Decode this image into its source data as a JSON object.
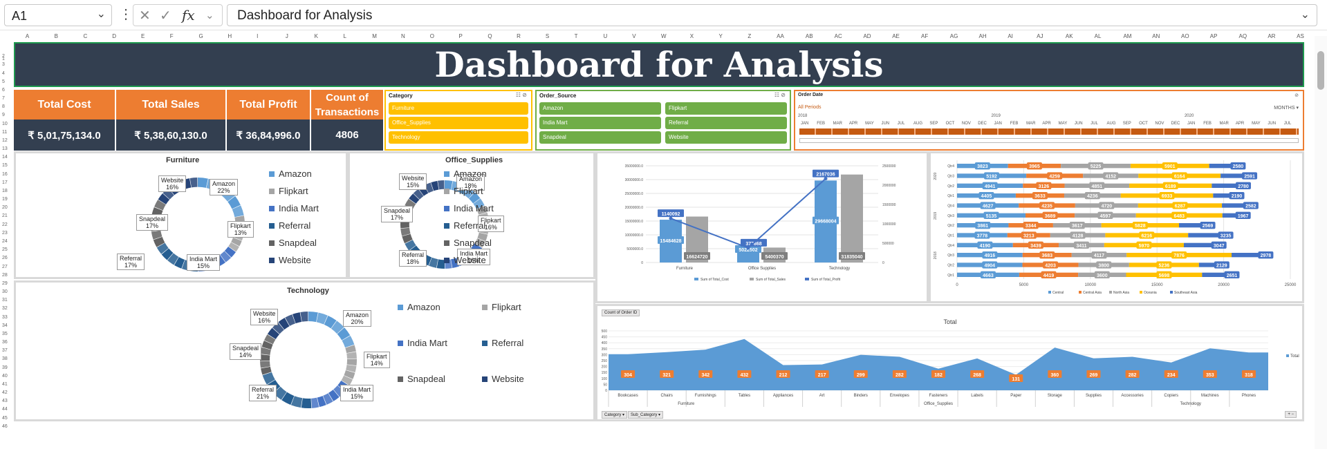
{
  "formula_bar": {
    "cell_ref": "A1",
    "formula": "Dashboard for Analysis"
  },
  "columns": [
    "A",
    "B",
    "C",
    "D",
    "E",
    "F",
    "G",
    "H",
    "I",
    "J",
    "K",
    "L",
    "M",
    "N",
    "O",
    "P",
    "Q",
    "R",
    "S",
    "T",
    "U",
    "V",
    "W",
    "X",
    "Y",
    "Z",
    "AA",
    "AB",
    "AC",
    "AD",
    "AE",
    "AF",
    "AG",
    "AH",
    "AI",
    "AJ",
    "AK",
    "AL",
    "AM",
    "AN",
    "AO",
    "AP",
    "AQ",
    "AR",
    "AS"
  ],
  "rows": [
    "1",
    "2",
    "3",
    "4",
    "5",
    "6",
    "7",
    "8",
    "9",
    "10",
    "11",
    "12",
    "13",
    "14",
    "15",
    "16",
    "17",
    "18",
    "19",
    "20",
    "21",
    "22",
    "23",
    "24",
    "25",
    "26",
    "27",
    "28",
    "29",
    "30",
    "31",
    "32",
    "33",
    "34",
    "35",
    "36",
    "37",
    "38",
    "39",
    "40",
    "41",
    "42",
    "43",
    "44",
    "45",
    "46"
  ],
  "title": "Dashboard for Analysis",
  "kpis": [
    {
      "label": "Total Cost",
      "value": "₹ 5,01,75,134.0"
    },
    {
      "label": "Total Sales",
      "value": "₹ 5,38,60,130.0"
    },
    {
      "label": "Total Profit",
      "value": "₹ 36,84,996.0"
    },
    {
      "label": "Count of Transactions",
      "value": "4806"
    }
  ],
  "slicer_category": {
    "title": "Category",
    "items": [
      "Furniture",
      "Office_Supplies",
      "Technology"
    ],
    "color": "#ffc000"
  },
  "slicer_order_source": {
    "title": "Order_Source",
    "items": [
      "Amazon",
      "Flipkart",
      "India Mart",
      "Referral",
      "Snapdeal",
      "Website"
    ],
    "color": "#70ad47"
  },
  "timeline": {
    "title": "Order Date",
    "period_label": "All Periods",
    "level": "MONTHS",
    "years": [
      "2018",
      "2019",
      "2020"
    ],
    "months": [
      "JAN",
      "FEB",
      "MAR",
      "APR",
      "MAY",
      "JUN",
      "JUL",
      "AUG",
      "SEP",
      "OCT",
      "NOV",
      "DEC",
      "JAN",
      "FEB",
      "MAR",
      "APR",
      "MAY",
      "JUN",
      "JUL",
      "AUG",
      "SEP",
      "OCT",
      "NOV",
      "DEC",
      "JAN",
      "FEB",
      "MAR",
      "APR",
      "MAY",
      "JUN",
      "JUL"
    ]
  },
  "colors": {
    "amazon": "#5b9bd5",
    "flipkart": "#a5a5a5",
    "india_mart": "#4472c4",
    "referral": "#255e91",
    "snapdeal": "#636363",
    "website": "#264478",
    "orange": "#ed7d31",
    "navy": "#333f50"
  },
  "pies": {
    "furniture": {
      "title": "Furniture",
      "legend": [
        "Amazon",
        "Flipkart",
        "India Mart",
        "Referral",
        "Snapdeal",
        "Website"
      ],
      "labels": [
        {
          "n": "Amazon",
          "p": "22%"
        },
        {
          "n": "Flipkart",
          "p": "13%"
        },
        {
          "n": "India Mart",
          "p": "15%"
        },
        {
          "n": "Referral",
          "p": "17%"
        },
        {
          "n": "Snapdeal",
          "p": "17%"
        },
        {
          "n": "Website",
          "p": "16%"
        }
      ]
    },
    "office": {
      "title": "Office_Supplies",
      "legend": [
        "Amazon",
        "Flipkart",
        "India Mart",
        "Referral",
        "Snapdeal",
        "Website"
      ],
      "labels": [
        {
          "n": "Amazon",
          "p": "18%"
        },
        {
          "n": "Flipkart",
          "p": "16%"
        },
        {
          "n": "India Mart",
          "p": "16%"
        },
        {
          "n": "Referral",
          "p": "18%"
        },
        {
          "n": "Snapdeal",
          "p": "17%"
        },
        {
          "n": "Website",
          "p": "15%"
        }
      ]
    },
    "technology": {
      "title": "Technology",
      "legend": [
        "Amazon",
        "Flipkart",
        "India Mart",
        "Referral",
        "Snapdeal",
        "Website"
      ],
      "labels": [
        {
          "n": "Amazon",
          "p": "20%"
        },
        {
          "n": "Flipkart",
          "p": "14%"
        },
        {
          "n": "India Mart",
          "p": "15%"
        },
        {
          "n": "Referral",
          "p": "21%"
        },
        {
          "n": "Snapdeal",
          "p": "14%"
        },
        {
          "n": "Website",
          "p": "16%"
        }
      ]
    }
  },
  "chart_data": [
    {
      "type": "bar",
      "title": "",
      "categories": [
        "Furniture",
        "Office Supplies",
        "Technology"
      ],
      "series": [
        {
          "name": "Sum of Total_Cost",
          "values": [
            15484628,
            5022502,
            29668004
          ]
        },
        {
          "name": "Sum of Total_Sales",
          "values": [
            16624720,
            5400370,
            31835040
          ]
        },
        {
          "name": "Sum of Total_Profit",
          "values": [
            1140092,
            377868,
            2167036
          ],
          "axis": "secondary",
          "type": "line"
        }
      ],
      "y_ticks": [
        "0",
        "5000000.0",
        "10000000.0",
        "15000000.0",
        "20000000.0",
        "25000000.0",
        "30000000.0",
        "35000000.0"
      ],
      "y2_ticks": [
        "0",
        "500000",
        "1000000",
        "1500000",
        "2000000",
        "2500000"
      ],
      "ylim": [
        0,
        35000000
      ],
      "y2lim": [
        0,
        2500000
      ],
      "legend": [
        "Sum of Total_Cost",
        "Sum of Total_Sales",
        "Sum of Total_Profit"
      ]
    },
    {
      "type": "bar",
      "orientation": "horizontal",
      "stacked": true,
      "categories": [
        "Qtr1 2018",
        "Qtr2 2018",
        "Qtr3 2018",
        "Qtr4 2018",
        "Qtr1 2019",
        "Qtr2 2019",
        "Qtr3 2019",
        "Qtr4 2019",
        "Qtr1 2020",
        "Qtr2 2020",
        "Qtr3 2020",
        "Qtr4 2020"
      ],
      "category_labels": [
        "Qtr1",
        "Qtr2",
        "Qtr3",
        "Qtr4",
        "Qtr1",
        "Qtr2",
        "Qtr3",
        "Qtr4",
        "Qtr1",
        "Qtr2",
        "Qtr3",
        "Qtr4"
      ],
      "year_labels": [
        "2018",
        "2019",
        "2020"
      ],
      "series": [
        {
          "name": "Central",
          "values": [
            4663,
            4904,
            4916,
            4190,
            3778,
            3861,
            5135,
            4627,
            4405,
            4941,
            5192,
            3823
          ]
        },
        {
          "name": "Central Asia",
          "values": [
            4419,
            4203,
            3683,
            3439,
            3213,
            3344,
            3689,
            4235,
            3633,
            3126,
            4259,
            3965
          ]
        },
        {
          "name": "North Asia",
          "values": [
            3600,
            3800,
            4117,
            3411,
            4128,
            3617,
            4597,
            4720,
            4236,
            4851,
            4152,
            5225
          ]
        },
        {
          "name": "Oceania",
          "values": [
            5698,
            5236,
            7876,
            5970,
            6216,
            5828,
            6483,
            6287,
            6933,
            6189,
            6164,
            5901
          ]
        },
        {
          "name": "Southeast Asia",
          "values": [
            2651,
            2129,
            2978,
            3047,
            3235,
            2569,
            1967,
            2582,
            2190,
            2780,
            2591,
            2580
          ]
        }
      ],
      "x_ticks": [
        "0",
        "5000",
        "10000",
        "15000",
        "20000",
        "25000"
      ],
      "xlim": [
        0,
        25000
      ],
      "legend": [
        "Central",
        "Central Asia",
        "North Asia",
        "Oceania",
        "Southeast Asia"
      ]
    },
    {
      "type": "area",
      "title": "Total",
      "button": "Count of Order ID",
      "categories": [
        "Bookcases",
        "Chairs",
        "Furnishings",
        "Tables",
        "Appliances",
        "Art",
        "Binders",
        "Envelopes",
        "Fasteners",
        "Labels",
        "Paper",
        "Storage",
        "Supplies",
        "Accessories",
        "Copiers",
        "Machines",
        "Phones"
      ],
      "groups": [
        {
          "name": "Furniture",
          "span": 4
        },
        {
          "name": "Office_Supplies",
          "span": 9
        },
        {
          "name": "Technology",
          "span": 4
        }
      ],
      "values": [
        304,
        321,
        342,
        432,
        212,
        217,
        299,
        282,
        182,
        268,
        131,
        360,
        269,
        282,
        234,
        353,
        318
      ],
      "y_ticks": [
        "0",
        "50",
        "100",
        "150",
        "200",
        "250",
        "300",
        "350",
        "400",
        "450",
        "500"
      ],
      "ylim": [
        0,
        500
      ],
      "legend": [
        "Total"
      ],
      "filters": [
        "Category",
        "Sub_Category"
      ]
    }
  ]
}
